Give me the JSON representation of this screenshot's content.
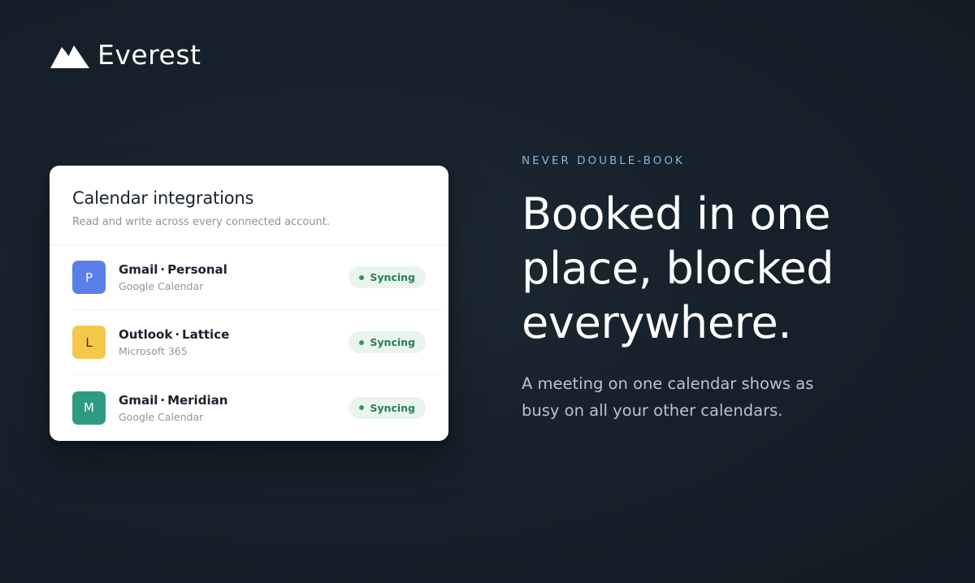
{
  "brand": {
    "name": "Everest",
    "logo_icon": "mountain-icon",
    "color": "#ffffff"
  },
  "card": {
    "title": "Calendar integrations",
    "subtitle": "Read and write across every connected account.",
    "accounts": [
      {
        "initial": "P",
        "name_primary": "Gmail",
        "separator": "·",
        "name_secondary": "Personal",
        "provider": "Google Calendar",
        "avatar_color": "#5b7fe8",
        "avatar_text_color": "#ffffff",
        "status": "Syncing"
      },
      {
        "initial": "L",
        "name_primary": "Outlook",
        "separator": "·",
        "name_secondary": "Lattice",
        "provider": "Microsoft 365",
        "avatar_color": "#f5c84a",
        "avatar_text_color": "#3a2e10",
        "status": "Syncing"
      },
      {
        "initial": "M",
        "name_primary": "Gmail",
        "separator": "·",
        "name_secondary": "Meridian",
        "provider": "Google Calendar",
        "avatar_color": "#2f9a82",
        "avatar_text_color": "#ffffff",
        "status": "Syncing"
      }
    ],
    "status_color": "#2e9a5f"
  },
  "hero": {
    "eyebrow": "NEVER DOUBLE-BOOK",
    "headline_lines": [
      "Booked in one",
      "place, blocked",
      "everywhere."
    ],
    "lead": "A meeting on one calendar shows as busy on all your other calendars.",
    "eyebrow_color": "#7fb5e0"
  }
}
